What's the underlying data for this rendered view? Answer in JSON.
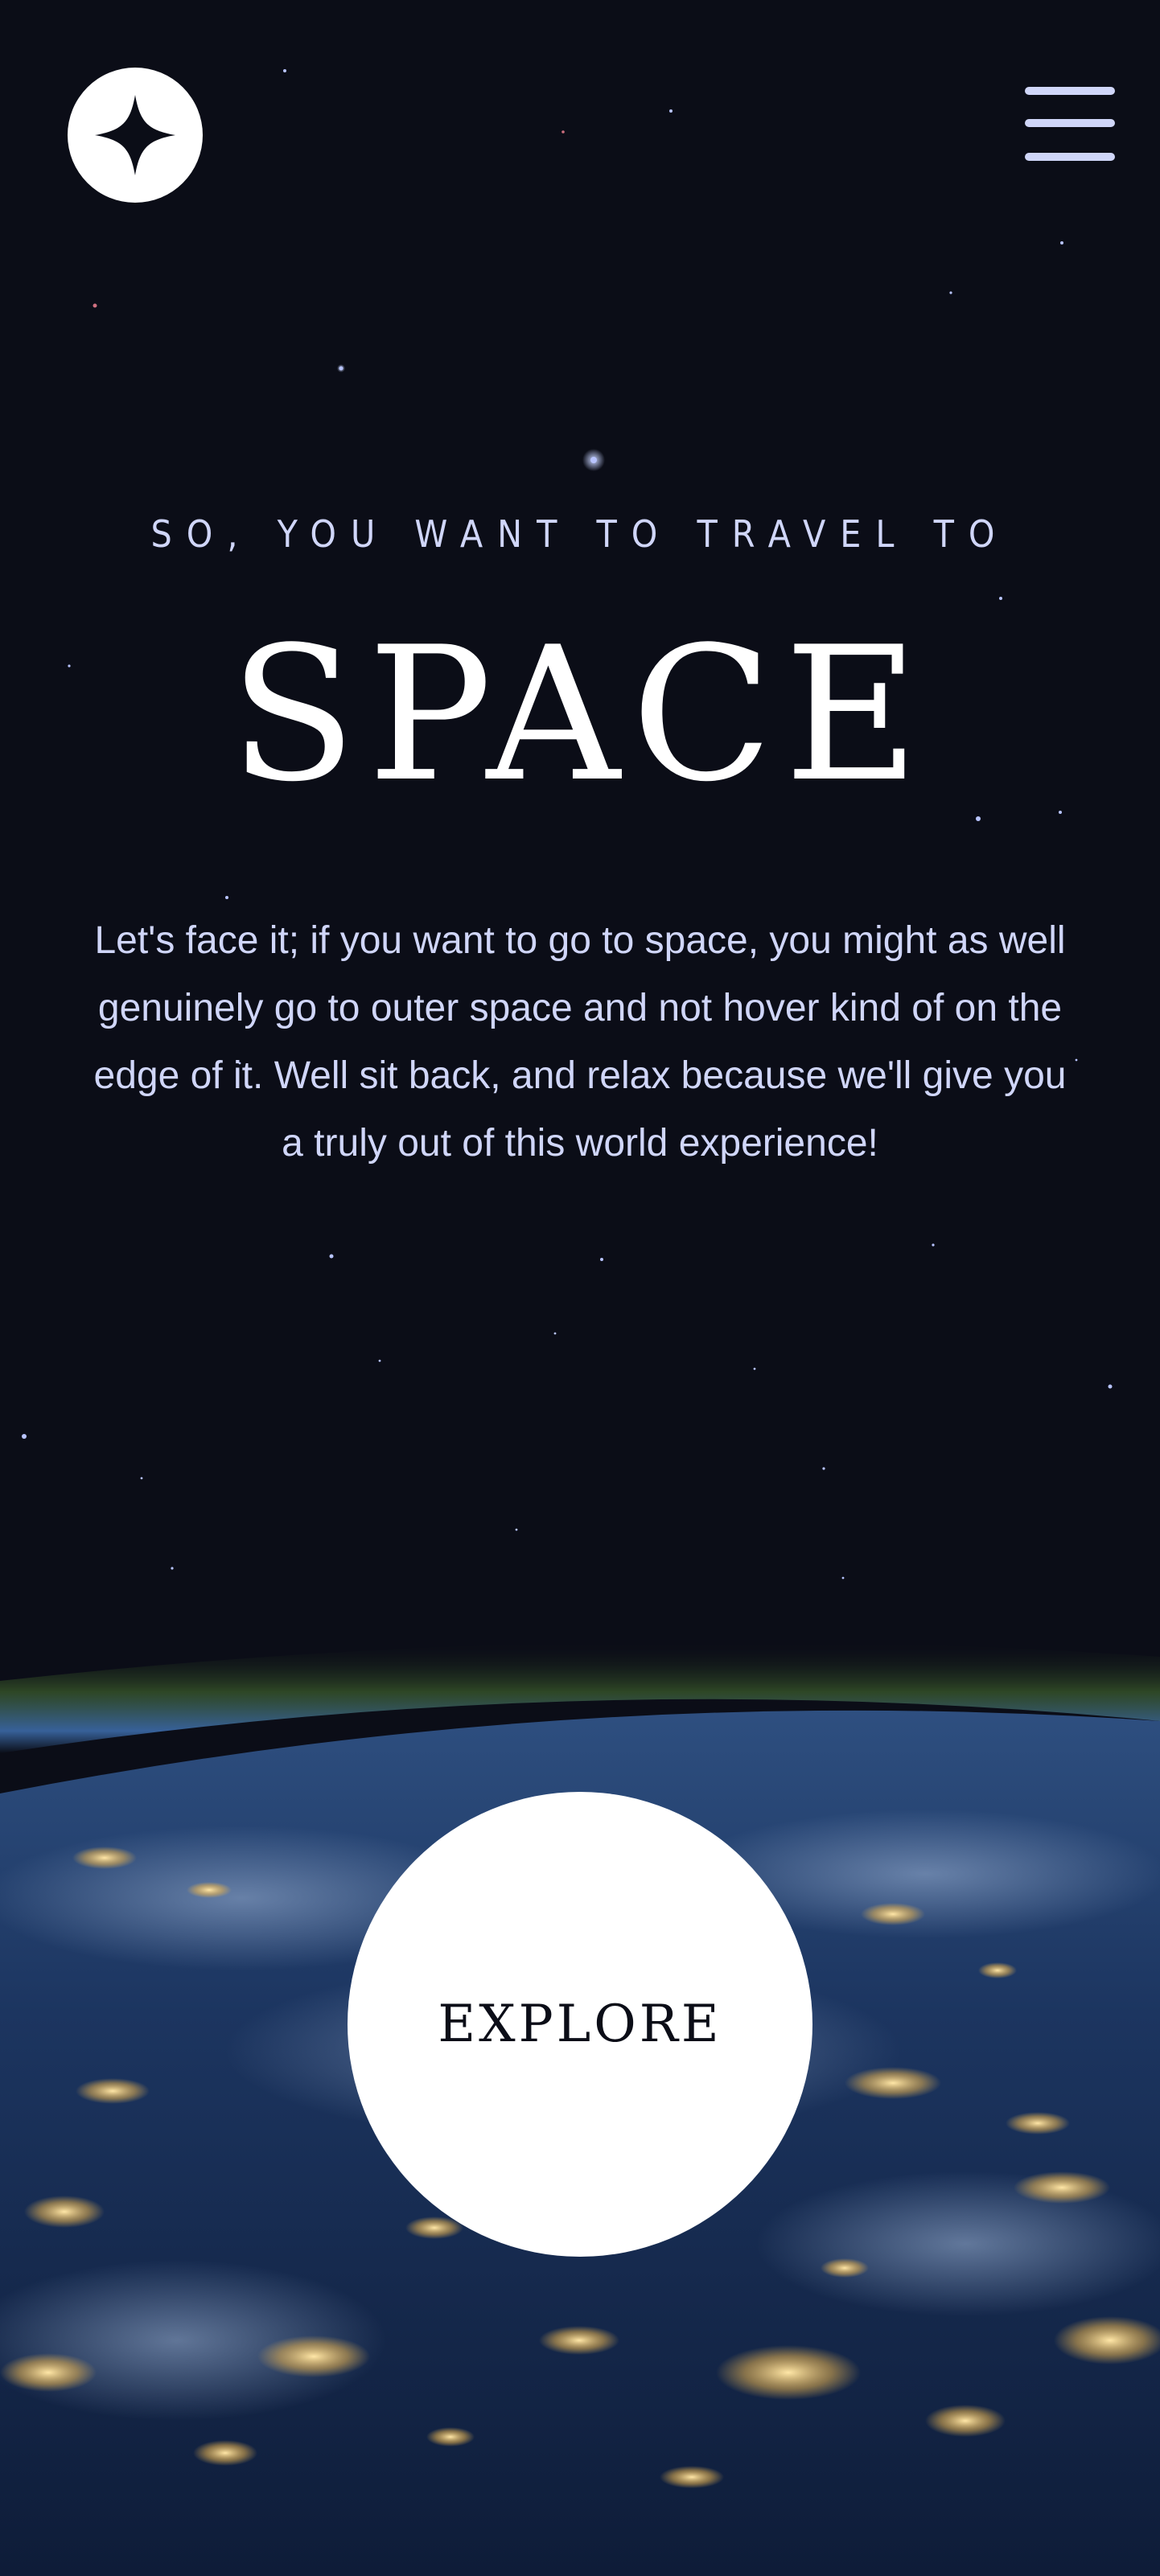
{
  "header": {
    "logo_icon": "star-logo-icon",
    "menu_icon": "hamburger-menu-icon"
  },
  "hero": {
    "eyebrow": "SO, YOU WANT TO TRAVEL TO",
    "title": "SPACE",
    "description": "Let's face it; if you want to go to space, you might as well genuinely go to outer space and not hover kind of on the edge of it. Well sit back, and relax because we'll give you a truly out of this world experience!"
  },
  "cta": {
    "label": "EXPLORE"
  },
  "colors": {
    "background": "#0b0d17",
    "accent_light": "#d0d6f9",
    "white": "#ffffff"
  }
}
